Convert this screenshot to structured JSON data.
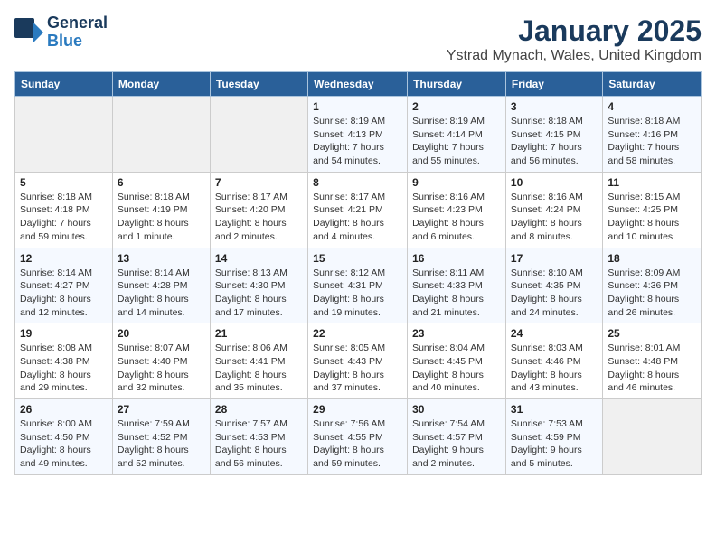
{
  "logo": {
    "line1": "General",
    "line2": "Blue",
    "icon": "▶"
  },
  "title": "January 2025",
  "subtitle": "Ystrad Mynach, Wales, United Kingdom",
  "weekdays": [
    "Sunday",
    "Monday",
    "Tuesday",
    "Wednesday",
    "Thursday",
    "Friday",
    "Saturday"
  ],
  "weeks": [
    [
      {
        "day": "",
        "sunrise": "",
        "sunset": "",
        "daylight": ""
      },
      {
        "day": "",
        "sunrise": "",
        "sunset": "",
        "daylight": ""
      },
      {
        "day": "",
        "sunrise": "",
        "sunset": "",
        "daylight": ""
      },
      {
        "day": "1",
        "sunrise": "Sunrise: 8:19 AM",
        "sunset": "Sunset: 4:13 PM",
        "daylight": "Daylight: 7 hours and 54 minutes."
      },
      {
        "day": "2",
        "sunrise": "Sunrise: 8:19 AM",
        "sunset": "Sunset: 4:14 PM",
        "daylight": "Daylight: 7 hours and 55 minutes."
      },
      {
        "day": "3",
        "sunrise": "Sunrise: 8:18 AM",
        "sunset": "Sunset: 4:15 PM",
        "daylight": "Daylight: 7 hours and 56 minutes."
      },
      {
        "day": "4",
        "sunrise": "Sunrise: 8:18 AM",
        "sunset": "Sunset: 4:16 PM",
        "daylight": "Daylight: 7 hours and 58 minutes."
      }
    ],
    [
      {
        "day": "5",
        "sunrise": "Sunrise: 8:18 AM",
        "sunset": "Sunset: 4:18 PM",
        "daylight": "Daylight: 7 hours and 59 minutes."
      },
      {
        "day": "6",
        "sunrise": "Sunrise: 8:18 AM",
        "sunset": "Sunset: 4:19 PM",
        "daylight": "Daylight: 8 hours and 1 minute."
      },
      {
        "day": "7",
        "sunrise": "Sunrise: 8:17 AM",
        "sunset": "Sunset: 4:20 PM",
        "daylight": "Daylight: 8 hours and 2 minutes."
      },
      {
        "day": "8",
        "sunrise": "Sunrise: 8:17 AM",
        "sunset": "Sunset: 4:21 PM",
        "daylight": "Daylight: 8 hours and 4 minutes."
      },
      {
        "day": "9",
        "sunrise": "Sunrise: 8:16 AM",
        "sunset": "Sunset: 4:23 PM",
        "daylight": "Daylight: 8 hours and 6 minutes."
      },
      {
        "day": "10",
        "sunrise": "Sunrise: 8:16 AM",
        "sunset": "Sunset: 4:24 PM",
        "daylight": "Daylight: 8 hours and 8 minutes."
      },
      {
        "day": "11",
        "sunrise": "Sunrise: 8:15 AM",
        "sunset": "Sunset: 4:25 PM",
        "daylight": "Daylight: 8 hours and 10 minutes."
      }
    ],
    [
      {
        "day": "12",
        "sunrise": "Sunrise: 8:14 AM",
        "sunset": "Sunset: 4:27 PM",
        "daylight": "Daylight: 8 hours and 12 minutes."
      },
      {
        "day": "13",
        "sunrise": "Sunrise: 8:14 AM",
        "sunset": "Sunset: 4:28 PM",
        "daylight": "Daylight: 8 hours and 14 minutes."
      },
      {
        "day": "14",
        "sunrise": "Sunrise: 8:13 AM",
        "sunset": "Sunset: 4:30 PM",
        "daylight": "Daylight: 8 hours and 17 minutes."
      },
      {
        "day": "15",
        "sunrise": "Sunrise: 8:12 AM",
        "sunset": "Sunset: 4:31 PM",
        "daylight": "Daylight: 8 hours and 19 minutes."
      },
      {
        "day": "16",
        "sunrise": "Sunrise: 8:11 AM",
        "sunset": "Sunset: 4:33 PM",
        "daylight": "Daylight: 8 hours and 21 minutes."
      },
      {
        "day": "17",
        "sunrise": "Sunrise: 8:10 AM",
        "sunset": "Sunset: 4:35 PM",
        "daylight": "Daylight: 8 hours and 24 minutes."
      },
      {
        "day": "18",
        "sunrise": "Sunrise: 8:09 AM",
        "sunset": "Sunset: 4:36 PM",
        "daylight": "Daylight: 8 hours and 26 minutes."
      }
    ],
    [
      {
        "day": "19",
        "sunrise": "Sunrise: 8:08 AM",
        "sunset": "Sunset: 4:38 PM",
        "daylight": "Daylight: 8 hours and 29 minutes."
      },
      {
        "day": "20",
        "sunrise": "Sunrise: 8:07 AM",
        "sunset": "Sunset: 4:40 PM",
        "daylight": "Daylight: 8 hours and 32 minutes."
      },
      {
        "day": "21",
        "sunrise": "Sunrise: 8:06 AM",
        "sunset": "Sunset: 4:41 PM",
        "daylight": "Daylight: 8 hours and 35 minutes."
      },
      {
        "day": "22",
        "sunrise": "Sunrise: 8:05 AM",
        "sunset": "Sunset: 4:43 PM",
        "daylight": "Daylight: 8 hours and 37 minutes."
      },
      {
        "day": "23",
        "sunrise": "Sunrise: 8:04 AM",
        "sunset": "Sunset: 4:45 PM",
        "daylight": "Daylight: 8 hours and 40 minutes."
      },
      {
        "day": "24",
        "sunrise": "Sunrise: 8:03 AM",
        "sunset": "Sunset: 4:46 PM",
        "daylight": "Daylight: 8 hours and 43 minutes."
      },
      {
        "day": "25",
        "sunrise": "Sunrise: 8:01 AM",
        "sunset": "Sunset: 4:48 PM",
        "daylight": "Daylight: 8 hours and 46 minutes."
      }
    ],
    [
      {
        "day": "26",
        "sunrise": "Sunrise: 8:00 AM",
        "sunset": "Sunset: 4:50 PM",
        "daylight": "Daylight: 8 hours and 49 minutes."
      },
      {
        "day": "27",
        "sunrise": "Sunrise: 7:59 AM",
        "sunset": "Sunset: 4:52 PM",
        "daylight": "Daylight: 8 hours and 52 minutes."
      },
      {
        "day": "28",
        "sunrise": "Sunrise: 7:57 AM",
        "sunset": "Sunset: 4:53 PM",
        "daylight": "Daylight: 8 hours and 56 minutes."
      },
      {
        "day": "29",
        "sunrise": "Sunrise: 7:56 AM",
        "sunset": "Sunset: 4:55 PM",
        "daylight": "Daylight: 8 hours and 59 minutes."
      },
      {
        "day": "30",
        "sunrise": "Sunrise: 7:54 AM",
        "sunset": "Sunset: 4:57 PM",
        "daylight": "Daylight: 9 hours and 2 minutes."
      },
      {
        "day": "31",
        "sunrise": "Sunrise: 7:53 AM",
        "sunset": "Sunset: 4:59 PM",
        "daylight": "Daylight: 9 hours and 5 minutes."
      },
      {
        "day": "",
        "sunrise": "",
        "sunset": "",
        "daylight": ""
      }
    ]
  ]
}
